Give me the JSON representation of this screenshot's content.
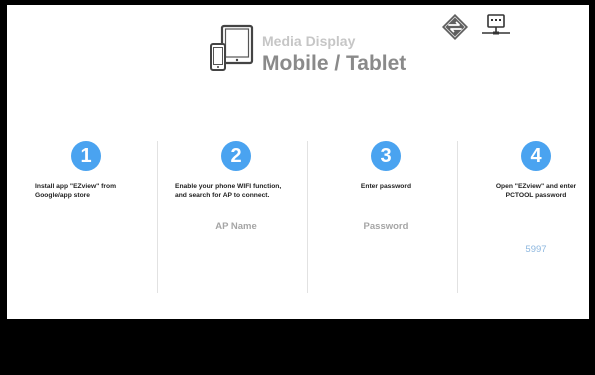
{
  "header": {
    "subtitle": "Media Display",
    "title": "Mobile / Tablet",
    "icons": [
      "devices-icon",
      "sync-diamond-icon",
      "network-icon"
    ]
  },
  "steps": [
    {
      "number": "1",
      "text_line1": "Install app \"EZview\" from",
      "text_line2": "Google/app store",
      "value": ""
    },
    {
      "number": "2",
      "text_line1": "Enable your phone WIFI function,",
      "text_line2": "and search for AP to connect.",
      "value": "AP Name"
    },
    {
      "number": "3",
      "text_line1": "Enter password",
      "text_line2": "",
      "value": "Password"
    },
    {
      "number": "4",
      "text_line1": "Open \"EZview\" and enter",
      "text_line2": "PCTOOL password",
      "value": "5997"
    }
  ],
  "colors": {
    "accent": "#4aa3f0",
    "value_blue": "#8db7df",
    "value_gray": "#a5a5a5"
  }
}
